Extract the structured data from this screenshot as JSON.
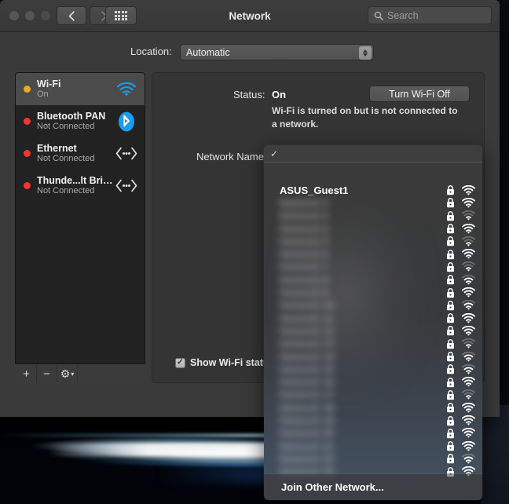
{
  "window": {
    "title": "Network",
    "search": {
      "placeholder": "Search",
      "icon": "search-icon"
    },
    "nav": {
      "back": "‹",
      "forward": "›",
      "showall": "grid-icon"
    },
    "traffic": [
      "close-button",
      "minimize-button",
      "zoom-button"
    ]
  },
  "location": {
    "label": "Location:",
    "value": "Automatic",
    "options": [
      "Automatic"
    ]
  },
  "sidebar": {
    "items": [
      {
        "name": "Wi-Fi",
        "status": "On",
        "dot": "#f0a81e",
        "icon": "wifi-icon",
        "selected": true
      },
      {
        "name": "Bluetooth PAN",
        "status": "Not Connected",
        "dot": "#f3372e",
        "icon": "bluetooth-icon",
        "selected": false
      },
      {
        "name": "Ethernet",
        "status": "Not Connected",
        "dot": "#f3372e",
        "icon": "ethernet-icon",
        "selected": false
      },
      {
        "name": "Thunde...lt Bridge",
        "status": "Not Connected",
        "dot": "#f3372e",
        "icon": "ethernet-icon",
        "selected": false
      }
    ],
    "toolbar": [
      {
        "label": "+",
        "name": "add-service-button"
      },
      {
        "label": "−",
        "name": "remove-service-button"
      },
      {
        "label": "⚙",
        "name": "action-menu-button"
      }
    ]
  },
  "main": {
    "status_label": "Status:",
    "status_value": "On",
    "status_description": "Wi-Fi is turned on but is not connected to a network.",
    "toggle_button": "Turn Wi-Fi Off",
    "network_name_label": "Network Name:",
    "show_status_label": "Show Wi-Fi status in menu bar",
    "show_status_checked": true,
    "checkbox_glyph": "✓"
  },
  "dropdown": {
    "header_check": "✓",
    "footer_label": "Join Other Network...",
    "rows": [
      {
        "ssid": "ASUS_Guest1",
        "locked": true,
        "bars": 3,
        "blurred": false
      },
      {
        "ssid": "Network 2",
        "locked": true,
        "bars": 3,
        "blurred": true
      },
      {
        "ssid": "Network 3",
        "locked": true,
        "bars": 1,
        "blurred": true
      },
      {
        "ssid": "Network 4",
        "locked": true,
        "bars": 3,
        "blurred": true
      },
      {
        "ssid": "Network 5",
        "locked": true,
        "bars": 1,
        "blurred": true
      },
      {
        "ssid": "Network 6",
        "locked": true,
        "bars": 3,
        "blurred": true
      },
      {
        "ssid": "Network 7",
        "locked": true,
        "bars": 1,
        "blurred": true
      },
      {
        "ssid": "Network 8",
        "locked": true,
        "bars": 2,
        "blurred": true
      },
      {
        "ssid": "Network 9",
        "locked": true,
        "bars": 3,
        "blurred": true
      },
      {
        "ssid": "Network 10",
        "locked": true,
        "bars": 2,
        "blurred": true
      },
      {
        "ssid": "Network 11",
        "locked": true,
        "bars": 3,
        "blurred": true
      },
      {
        "ssid": "Network 12",
        "locked": true,
        "bars": 3,
        "blurred": true
      },
      {
        "ssid": "Network 13",
        "locked": true,
        "bars": 1,
        "blurred": true
      },
      {
        "ssid": "Network 14",
        "locked": true,
        "bars": 2,
        "blurred": true
      },
      {
        "ssid": "Network 15",
        "locked": true,
        "bars": 2,
        "blurred": true
      },
      {
        "ssid": "Network 16",
        "locked": true,
        "bars": 3,
        "blurred": true
      },
      {
        "ssid": "Network 17",
        "locked": true,
        "bars": 1,
        "blurred": true
      },
      {
        "ssid": "Network 18",
        "locked": true,
        "bars": 3,
        "blurred": true
      },
      {
        "ssid": "Network 19",
        "locked": true,
        "bars": 3,
        "blurred": true
      },
      {
        "ssid": "Network 20",
        "locked": true,
        "bars": 3,
        "blurred": true
      },
      {
        "ssid": "Network 21",
        "locked": true,
        "bars": 3,
        "blurred": true
      },
      {
        "ssid": "Network 22",
        "locked": true,
        "bars": 2,
        "blurred": true
      },
      {
        "ssid": "Network 23",
        "locked": true,
        "bars": 3,
        "blurred": true
      }
    ]
  },
  "colors": {
    "accent_blue": "#1a9cf0",
    "status_on": "#f0a81e",
    "status_off": "#f3372e",
    "window_bg": "#3a3a3a",
    "sidebar_bg": "#222222"
  }
}
